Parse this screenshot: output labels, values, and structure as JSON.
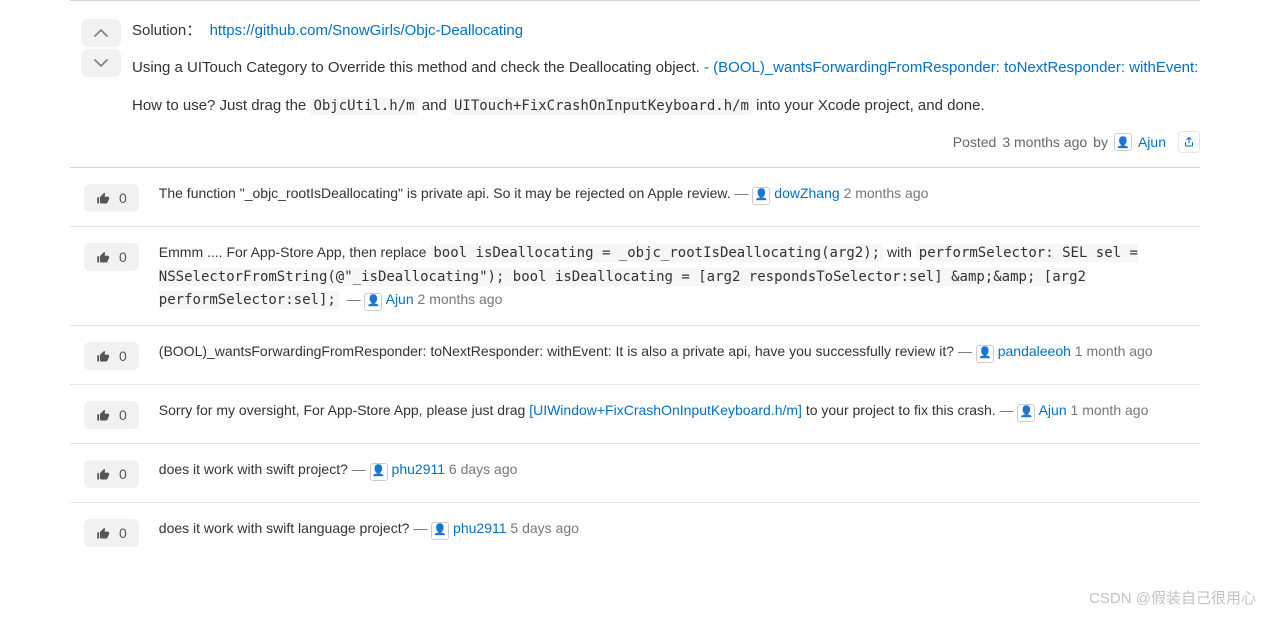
{
  "post": {
    "solution_label": "Solution：",
    "solution_link": "https://github.com/SnowGirls/Objc-Deallocating",
    "para1_a": "Using a UITouch Category to Override this method and check the Deallocating object. ",
    "para1_link": "- (BOOL)_wantsForwardingFromResponder: toNextResponder: withEvent:",
    "para2_a": "How to use? Just drag the ",
    "para2_code1": "ObjcUtil.h/m",
    "para2_b": " and ",
    "para2_code2": "UITouch+FixCrashOnInputKeyboard.h/m",
    "para2_c": " into your Xcode project, and done.",
    "posted_label": "Posted",
    "posted_time": "3 months ago",
    "posted_by": "by",
    "author": "Ajun"
  },
  "comments": [
    {
      "votes": "0",
      "text_a": "The function \"_objc_rootIsDeallocating\" is private api. So it may be rejected on Apple review.",
      "author": "dowZhang",
      "time": "2 months ago"
    },
    {
      "votes": "0",
      "text_a": "Emmm .... For App-Store App, then replace ",
      "code1": "bool isDeallocating = _objc_rootIsDeallocating(arg2);",
      "text_b": " with ",
      "code2": "performSelector: SEL sel = NSSelectorFromString(@\"_isDeallocating\"); bool isDeallocating = [arg2 respondsToSelector:sel] &amp;&amp; [arg2 performSelector:sel];",
      "author": "Ajun",
      "time": "2 months ago"
    },
    {
      "votes": "0",
      "text_a": "(BOOL)_wantsForwardingFromResponder: toNextResponder: withEvent: It is also a private api, have you successfully review it?",
      "author": "pandaleeoh",
      "time": "1 month ago"
    },
    {
      "votes": "0",
      "text_a": "Sorry for my oversight, For App-Store App, please just drag ",
      "link": "[UIWindow+FixCrashOnInputKeyboard.h/m]",
      "text_b": " to your project to fix this crash.",
      "author": "Ajun",
      "time": "1 month ago"
    },
    {
      "votes": "0",
      "text_a": "does it work with swift project?",
      "author": "phu2911",
      "time": "6 days ago"
    },
    {
      "votes": "0",
      "text_a": "does it work with swift language project?",
      "author": "phu2911",
      "time": "5 days ago"
    }
  ],
  "watermark": "CSDN @假装自己很用心"
}
